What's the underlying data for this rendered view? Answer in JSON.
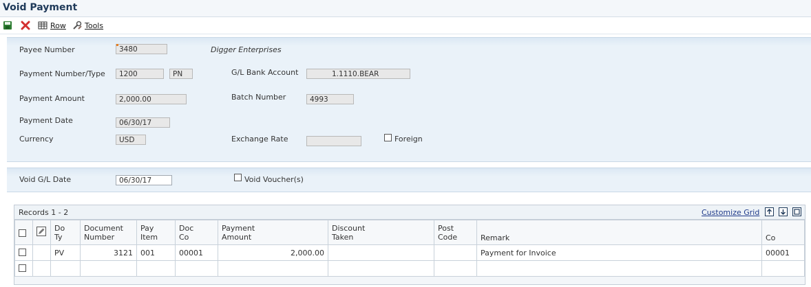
{
  "title": "Void Payment",
  "toolbar": {
    "row_label": "Row",
    "tools_label": "Tools"
  },
  "payment": {
    "payee_number_label": "Payee Number",
    "payee_number": "3480",
    "payee_name": "Digger Enterprises",
    "payment_number_type_label": "Payment Number/Type",
    "payment_number": "1200",
    "payment_type": "PN",
    "gl_bank_account_label": "G/L Bank Account",
    "gl_bank_account": "1.1110.BEAR",
    "payment_amount_label": "Payment Amount",
    "payment_amount": "2,000.00",
    "batch_number_label": "Batch Number",
    "batch_number": "4993",
    "payment_date_label": "Payment Date",
    "payment_date": "06/30/17",
    "currency_label": "Currency",
    "currency": "USD",
    "exchange_rate_label": "Exchange Rate",
    "exchange_rate": "",
    "foreign_label": "Foreign",
    "foreign_checked": false
  },
  "void": {
    "void_gl_date_label": "Void G/L Date",
    "void_gl_date": "06/30/17",
    "void_vouchers_label": "Void Voucher(s)",
    "void_vouchers_checked": false
  },
  "grid": {
    "records_label": "Records 1 - 2",
    "customize_label": "Customize Grid",
    "columns": {
      "do_ty_1": "Do",
      "do_ty_2": "Ty",
      "document_number_1": "Document",
      "document_number_2": "Number",
      "pay_item_1": "Pay",
      "pay_item_2": "Item",
      "doc_co_1": "Doc",
      "doc_co_2": "Co",
      "payment_amount_1": "Payment",
      "payment_amount_2": "Amount",
      "discount_taken_1": "Discount",
      "discount_taken_2": "Taken",
      "post_code_1": "Post",
      "post_code_2": "Code",
      "remark": "Remark",
      "co": "Co"
    },
    "rows": [
      {
        "do_ty": "PV",
        "document_number": "3121",
        "pay_item": "001",
        "doc_co": "00001",
        "payment_amount": "2,000.00",
        "discount_taken": "",
        "post_code": "",
        "remark": "Payment for Invoice",
        "co": "00001"
      }
    ]
  },
  "colors": {
    "title": "#1f3a5a",
    "panel_bg": "#eaf2f9",
    "save_icon": "#2e7d32",
    "cancel_icon": "#d32f2f",
    "link": "#1f3a8a"
  }
}
